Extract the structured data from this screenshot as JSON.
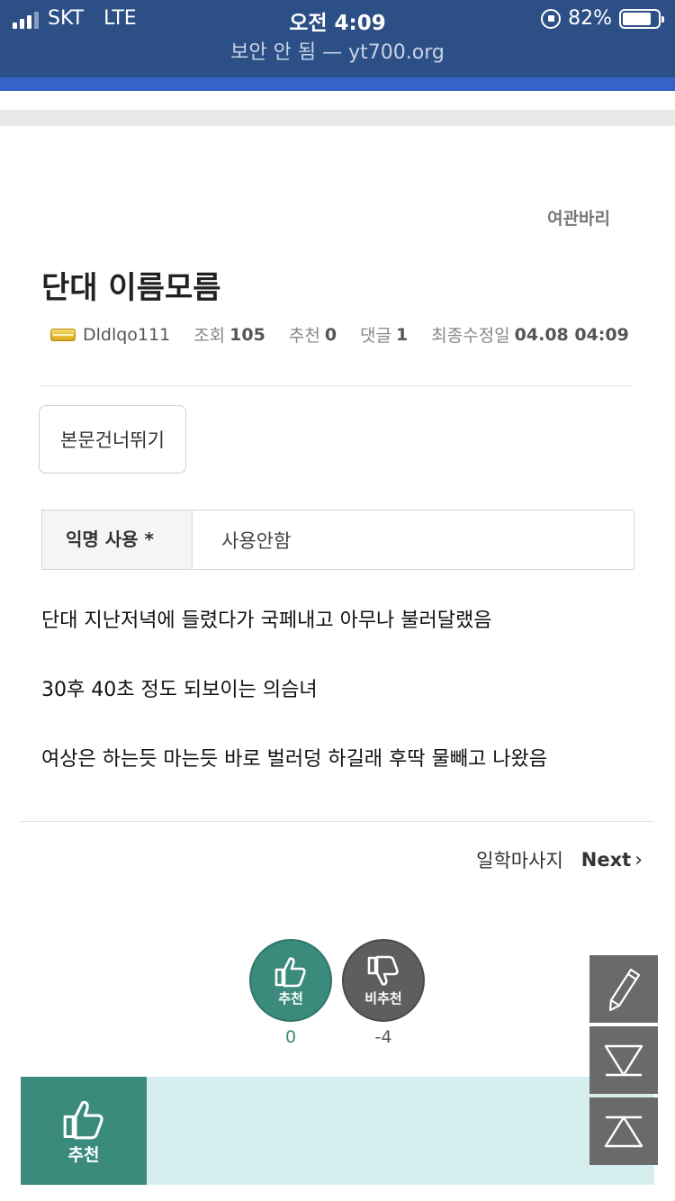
{
  "status_bar": {
    "carrier": "SKT",
    "network": "LTE",
    "time": "오전 4:09",
    "battery": "82%",
    "battery_level": 0.82,
    "url": "보안 안 됨 — yt700.org"
  },
  "post": {
    "category": "여관바리",
    "title": "단대 이름모름",
    "author": "Dldlqo111",
    "views_label": "조회",
    "views": "105",
    "recommend_label": "추천",
    "recommend": "0",
    "comments_label": "댓글",
    "comments": "1",
    "modified_label": "최종수정일",
    "modified": "04.08 04:09"
  },
  "skip_button": "본문건너뛰기",
  "anonymous": {
    "label": "익명 사용 *",
    "value": "사용안함"
  },
  "body": [
    "단대 지난저녁에 들렸다가 국페내고 아무나 불러달랬음",
    "30후 40초 정도 되보이는 의슴녀",
    "여상은 하는듯 마는듯 바로 벌러덩 하길래 후딱 물빼고 나왔음"
  ],
  "next_nav": {
    "title": "일학마사지",
    "label": "Next",
    "chevron": "›"
  },
  "vote": {
    "up_label": "추천",
    "up_count": "0",
    "down_label": "비추천",
    "down_count": "-4"
  },
  "banner": {
    "label": "추천"
  },
  "colors": {
    "status_bar": "#2c4f86",
    "accent_blue": "#3563c9",
    "recommend_green": "#3b8b7d",
    "banner_bg": "#d6efee",
    "fab_gray": "#6a6a6a"
  },
  "icons": [
    "signal-icon",
    "rotation-lock-icon",
    "battery-icon",
    "level-badge-icon",
    "thumbs-up-icon",
    "thumbs-down-icon",
    "pencil-icon",
    "triangle-down-icon",
    "triangle-up-icon"
  ]
}
